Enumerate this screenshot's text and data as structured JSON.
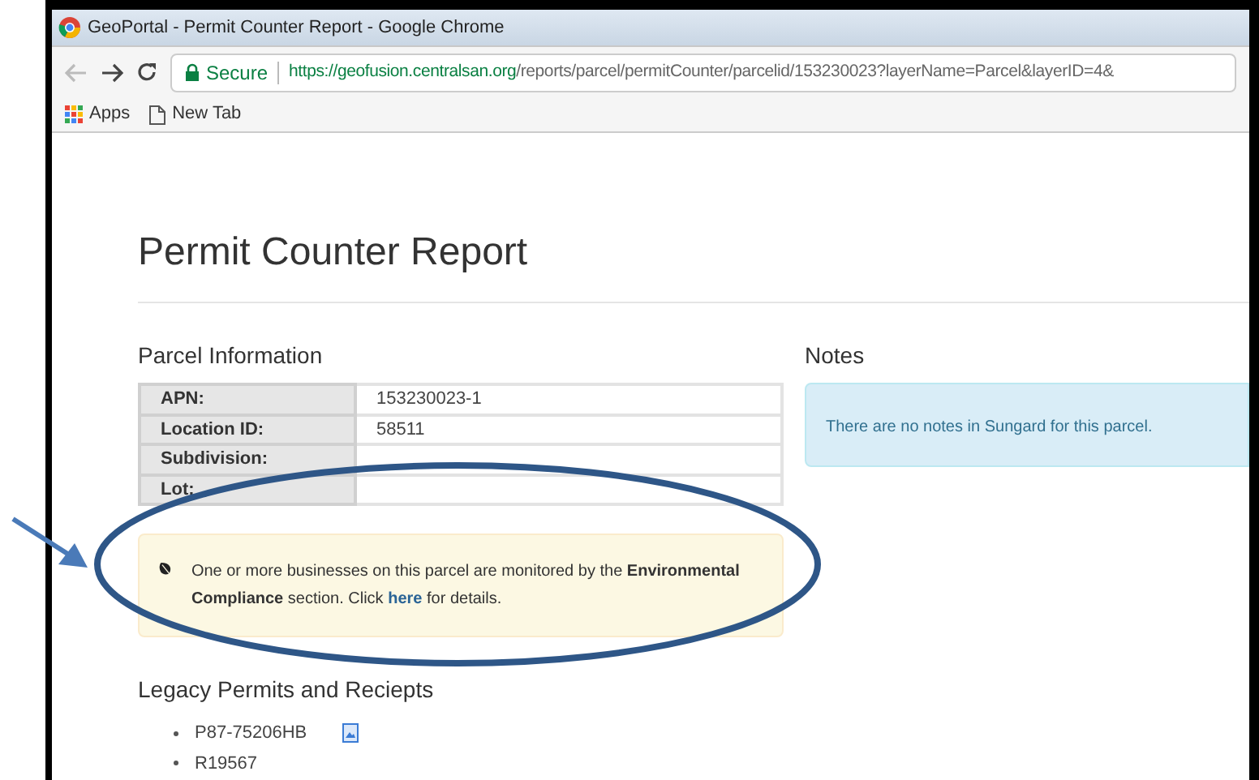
{
  "window": {
    "title": "GeoPortal - Permit Counter Report - Google Chrome"
  },
  "address_bar": {
    "secure_label": "Secure",
    "url_host": "https://geofusion.centralsan.org",
    "url_path": "/reports/parcel/permitCounter/parcelid/153230023?layerName=Parcel&layerID=4&"
  },
  "bookmarks": [
    {
      "label": "Apps",
      "kind": "apps"
    },
    {
      "label": "New Tab",
      "kind": "page"
    }
  ],
  "page": {
    "title": "Permit Counter Report",
    "parcel_information": {
      "heading": "Parcel Information",
      "rows": [
        {
          "label": "APN:",
          "value": "153230023-1"
        },
        {
          "label": "Location ID:",
          "value": "58511"
        },
        {
          "label": "Subdivision:",
          "value": ""
        },
        {
          "label": "Lot:",
          "value": ""
        }
      ]
    },
    "alert": {
      "text_before": "One or more businesses on this parcel are monitored by the **Environmental Compliance** section. Click ",
      "link": "here",
      "text_after": " for details."
    },
    "notes": {
      "heading": "Notes",
      "message": "There are no notes in Sungard for this parcel."
    },
    "legacy": {
      "heading": "Legacy Permits and Reciepts",
      "items": [
        {
          "label": "P87-75206HB",
          "has_document": true
        },
        {
          "label": "R19567",
          "has_document": false
        }
      ]
    }
  }
}
